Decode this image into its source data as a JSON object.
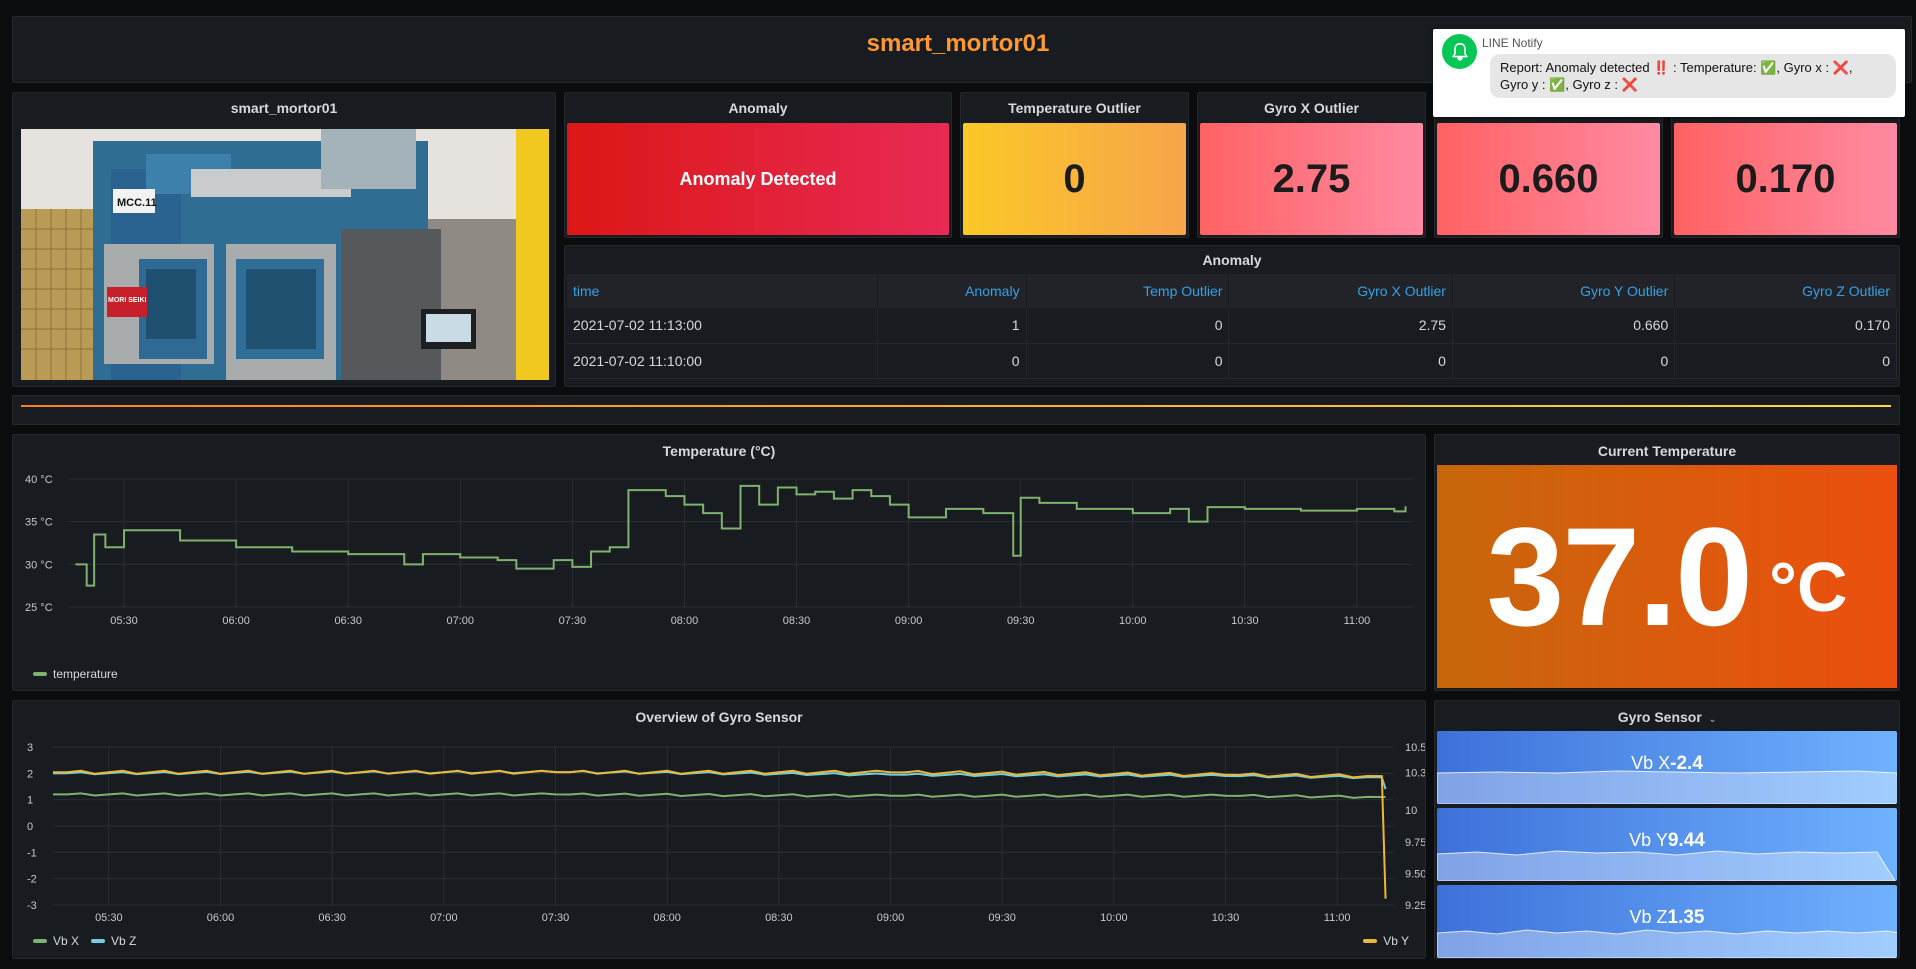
{
  "header": {
    "title": "smart_mortor01"
  },
  "notify": {
    "app": "LINE Notify",
    "line1": "Report: Anomaly detected ‼️ : Temperature: ✅, Gyro x : ❌,",
    "line2": "Gyro y : ✅, Gyro z : ❌"
  },
  "photo_panel": {
    "title": "smart_mortor01",
    "machine_tag": "MCC.11",
    "brand_text": "MORI SEIKI"
  },
  "stats": {
    "anomaly": {
      "title": "Anomaly",
      "value": "Anomaly Detected"
    },
    "temp_outlier": {
      "title": "Temperature Outlier",
      "value": "0"
    },
    "gyro_x_outlier": {
      "title": "Gyro X Outlier",
      "value": "2.75"
    },
    "gyro_y_outlier": {
      "value": "0.660"
    },
    "gyro_z_outlier": {
      "value": "0.170"
    }
  },
  "anomaly_table": {
    "title": "Anomaly",
    "columns": [
      "time",
      "Anomaly",
      "Temp Outlier",
      "Gyro X Outlier",
      "Gyro Y Outlier",
      "Gyro Z Outlier"
    ],
    "rows": [
      [
        "2021-07-02 11:13:00",
        "1",
        "0",
        "2.75",
        "0.660",
        "0.170"
      ],
      [
        "2021-07-02 11:10:00",
        "0",
        "0",
        "0",
        "0",
        "0"
      ]
    ]
  },
  "temperature_chart": {
    "title": "Temperature (°C)",
    "legend": "temperature",
    "yticks": [
      "40 °C",
      "35 °C",
      "30 °C",
      "25 °C"
    ],
    "xticks": [
      "05:30",
      "06:00",
      "06:30",
      "07:00",
      "07:30",
      "08:00",
      "08:30",
      "09:00",
      "09:30",
      "10:00",
      "10:30",
      "11:00"
    ],
    "color": "#7eb26d"
  },
  "current_temp": {
    "title": "Current Temperature",
    "value": "37.0",
    "unit": "°C"
  },
  "gyro_chart": {
    "title": "Overview of Gyro Sensor",
    "yticks_left": [
      "3",
      "2",
      "1",
      "0",
      "-1",
      "-2",
      "-3"
    ],
    "yticks_right": [
      "10.5",
      "10.3",
      "10",
      "9.75",
      "9.50",
      "9.25"
    ],
    "xticks": [
      "05:30",
      "06:00",
      "06:30",
      "07:00",
      "07:30",
      "08:00",
      "08:30",
      "09:00",
      "09:30",
      "10:00",
      "10:30",
      "11:00"
    ],
    "legend_left": [
      {
        "name": "Vb X",
        "color": "#7eb26d"
      },
      {
        "name": "Vb Z",
        "color": "#6ed0e0"
      }
    ],
    "legend_right": [
      {
        "name": "Vb Y",
        "color": "#eab839"
      }
    ]
  },
  "gyro_sensor": {
    "title": "Gyro Sensor",
    "tiles": [
      {
        "prefix": "Vb X",
        "value": "-2.4"
      },
      {
        "prefix": "Vb Y",
        "value": "9.44"
      },
      {
        "prefix": "Vb Z",
        "value": "1.35"
      }
    ]
  },
  "chart_data": [
    {
      "type": "line",
      "title": "Temperature (°C)",
      "ylim": [
        25,
        40
      ],
      "xlim": [
        "05:15",
        "11:15"
      ],
      "series": [
        {
          "name": "temperature",
          "x": [
            "05:17",
            "05:20",
            "05:22",
            "05:25",
            "05:30",
            "05:45",
            "06:00",
            "06:15",
            "06:30",
            "06:45",
            "06:50",
            "07:00",
            "07:10",
            "07:15",
            "07:25",
            "07:30",
            "07:35",
            "07:40",
            "07:45",
            "07:55",
            "08:00",
            "08:05",
            "08:10",
            "08:15",
            "08:20",
            "08:25",
            "08:30",
            "08:35",
            "08:40",
            "08:45",
            "08:50",
            "08:55",
            "09:00",
            "09:10",
            "09:20",
            "09:28",
            "09:30",
            "09:35",
            "09:45",
            "10:00",
            "10:10",
            "10:15",
            "10:20",
            "10:30",
            "10:45",
            "11:00",
            "11:10",
            "11:13"
          ],
          "values": [
            30,
            27.5,
            33.5,
            32,
            34,
            32.8,
            32,
            31.5,
            31.2,
            30,
            31.2,
            30.8,
            30.5,
            29.5,
            30.5,
            29.7,
            31.5,
            32,
            38.7,
            38,
            37,
            36,
            34.2,
            39.2,
            37,
            39,
            38.2,
            38.5,
            37.7,
            38.7,
            38,
            37,
            35.5,
            36.5,
            36,
            31,
            37.8,
            37.2,
            36.5,
            36,
            36.5,
            35,
            36.7,
            36.5,
            36.3,
            36.5,
            36.2,
            36.8
          ]
        }
      ]
    },
    {
      "type": "line",
      "title": "Overview of Gyro Sensor",
      "ylim": [
        -3,
        3
      ],
      "y2lim": [
        9.25,
        10.5
      ],
      "xlim": [
        "05:15",
        "11:15"
      ],
      "series": [
        {
          "name": "Vb X",
          "axis": "left",
          "x": [
            "05:15",
            "07:30",
            "09:00",
            "10:30",
            "11:12",
            "11:13"
          ],
          "values": [
            1.2,
            1.2,
            1.15,
            1.15,
            1.1,
            1.1
          ]
        },
        {
          "name": "Vb Z",
          "axis": "left",
          "x": [
            "05:15",
            "07:30",
            "09:00",
            "10:30",
            "11:12",
            "11:13"
          ],
          "values": [
            2.0,
            2.05,
            1.95,
            1.9,
            1.85,
            1.4
          ]
        },
        {
          "name": "Vb Y",
          "axis": "right",
          "x": [
            "05:15",
            "07:30",
            "09:00",
            "10:30",
            "11:12",
            "11:13"
          ],
          "values": [
            10.3,
            10.3,
            10.3,
            10.28,
            10.27,
            9.3
          ]
        }
      ]
    }
  ]
}
